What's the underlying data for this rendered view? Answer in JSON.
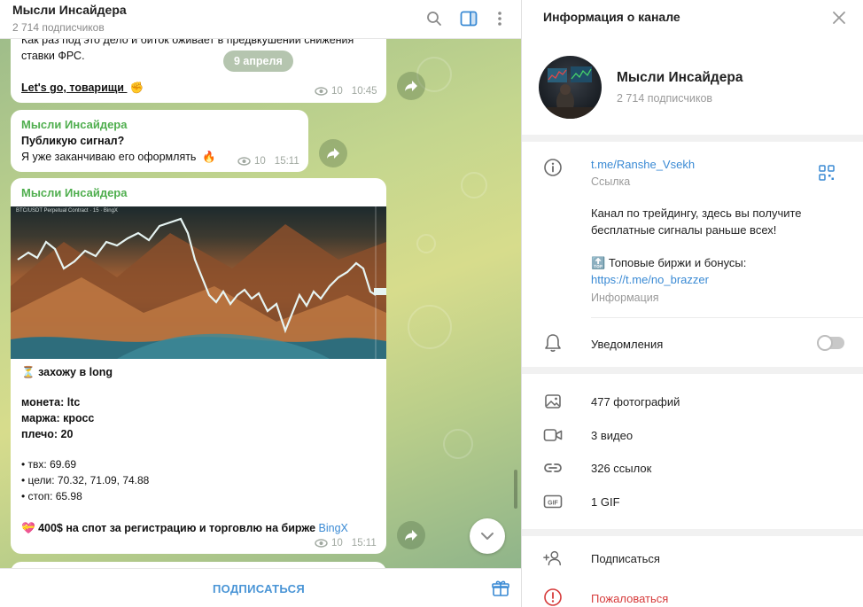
{
  "chat": {
    "title": "Мысли Инсайдера",
    "subscribers": "2 714 подписчиков",
    "date_pill": "9 апреля",
    "messages": [
      {
        "text_top": "Как раз под это дело и биток оживает в предвкушении снижения",
        "text_top2": "ставки ФРС.",
        "text_link": "Let's go, товарищи",
        "emoji": "✊",
        "views": "10",
        "time": "10:45"
      },
      {
        "sender": "Мысли Инсайдера",
        "line1": "Публикую сигнал?",
        "line2": "Я уже заканчиваю его оформлять",
        "emoji": "🔥",
        "views": "10",
        "time": "15:11"
      },
      {
        "sender": "Мысли Инсайдера",
        "photo_caption": "BTC/USDT Perpetual Contract · 15 · BingX",
        "heading_emoji": "⏳",
        "heading": "захожу в long",
        "coin": "монета: ltc",
        "margin": "маржа: кросс",
        "leverage": "плечо: 20",
        "entry": "• твх: 69.69",
        "targets": "• цели: 70.32, 71.09, 74.88",
        "stop": "• стоп: 65.98",
        "promo_emoji": "💝",
        "promo": "400$ на спот за регистрацию и торговлю на бирже",
        "promo_link": "BingX",
        "views": "10",
        "time": "15:11"
      }
    ],
    "footer_button": "ПОДПИСАТЬСЯ"
  },
  "info": {
    "title": "Информация о канале",
    "channel_name": "Мысли Инсайдера",
    "subscribers": "2 714 подписчиков",
    "link": "t.me/Ranshe_Vsekh",
    "link_label": "Ссылка",
    "description_1": "Канал по трейдингу, здесь вы получите",
    "description_2": "бесплатные сигналы раньше всех!",
    "description_3_emoji": "🔝",
    "description_3": "Топовые биржи и бонусы:",
    "description_link": "https://t.me/no_brazzer",
    "description_label": "Информация",
    "notifications": "Уведомления",
    "notifications_on": false,
    "media": {
      "photos": "477 фотографий",
      "videos": "3 видео",
      "links": "326 ссылок",
      "gifs": "1 GIF"
    },
    "subscribe": "Подписаться",
    "report": "Пожаловаться"
  },
  "colors": {
    "accent": "#3a8ad4",
    "sender": "#4fae4e",
    "danger": "#d63b3b"
  }
}
